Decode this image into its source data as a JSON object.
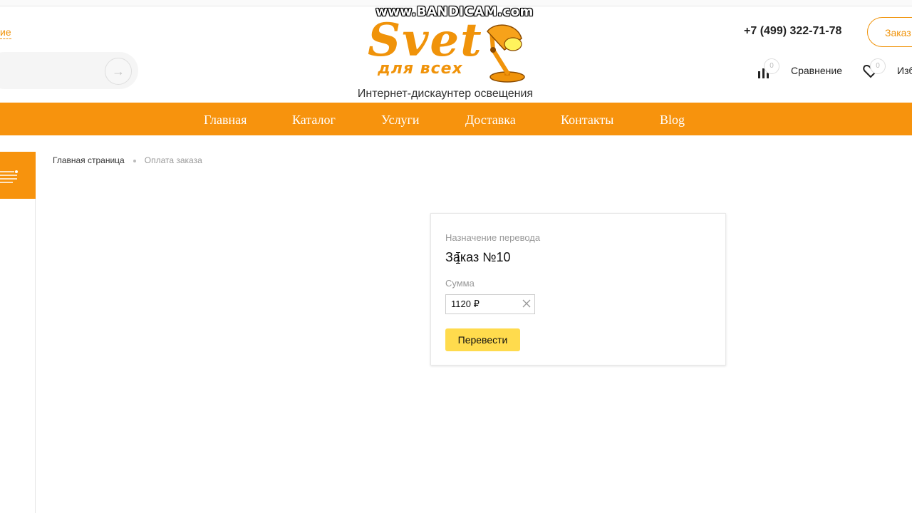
{
  "recorder": {
    "watermark": "www.BANDICAM.com"
  },
  "header": {
    "left_link": "ие",
    "search_submit_icon": "arrow-right-icon",
    "logo": {
      "word": "Svet",
      "sub": "для всех"
    },
    "tagline": "Интернет-дискаунтер освещения",
    "phone": "+7 (499) 322-71-78",
    "order_button": "Заказ",
    "compare": {
      "count": "0",
      "label": "Сравнение"
    },
    "favorites": {
      "count": "0",
      "label": "Изб"
    }
  },
  "nav": {
    "items": [
      {
        "label": "Главная"
      },
      {
        "label": "Каталог"
      },
      {
        "label": "Услуги"
      },
      {
        "label": "Доставка"
      },
      {
        "label": "Контакты"
      },
      {
        "label": "Blog"
      }
    ]
  },
  "breadcrumb": {
    "home": "Главная страница",
    "current": "Оплата заказа"
  },
  "payment": {
    "purpose_label": "Назначение перевода",
    "purpose_value": "Заказ №10",
    "sum_label": "Сумма",
    "sum_value": "1120 ₽",
    "submit": "Перевести"
  },
  "colors": {
    "brand_orange": "#f7930d",
    "pay_button": "#ffdb4d"
  }
}
